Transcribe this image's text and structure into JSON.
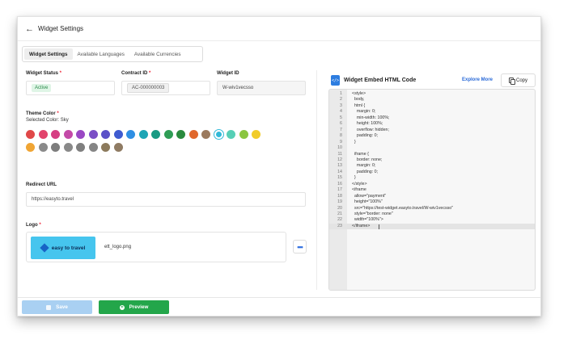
{
  "header": {
    "title": "Widget Settings"
  },
  "tabs": [
    {
      "label": "Widget Settings",
      "active": true
    },
    {
      "label": "Available Languages",
      "active": false
    },
    {
      "label": "Available Currencies",
      "active": false
    }
  ],
  "form": {
    "status": {
      "label": "Widget Status",
      "value": "Active"
    },
    "contract": {
      "label": "Contract ID",
      "value": "AC-000000003"
    },
    "widget_id": {
      "label": "Widget ID",
      "value": "W-wiv1vecsso"
    },
    "theme": {
      "label": "Theme Color",
      "selected_text": "Selected Color: Sky",
      "colors": [
        "#e04848",
        "#e2446c",
        "#d63f83",
        "#c44aa8",
        "#9a48c4",
        "#7b4fc6",
        "#5b52c8",
        "#3f5bd0",
        "#2f8fe3",
        "#1da5b5",
        "#199a83",
        "#2f9d55",
        "#2a8a3e",
        "#e0672c",
        "#9b7a5e",
        "#31b9d8",
        "#56cfb6",
        "#8ac540",
        "#f1cc2a",
        "#f0a534",
        "#8a8a8a",
        "#7d7d7d",
        "#898989",
        "#7f7f7f",
        "#858585",
        "#8c7a5c",
        "#8f7b63"
      ],
      "selected_index": 15
    },
    "redirect": {
      "label": "Redirect URL",
      "value": "https://easyto.travel"
    },
    "logo": {
      "label": "Logo",
      "brand_text": "easy to travel",
      "filename": "ett_logo.png",
      "more": "•••"
    }
  },
  "embed": {
    "icon_text": "</>",
    "title": "Widget Embed HTML Code",
    "explore": "Explore More",
    "copy": "Copy",
    "lines": [
      "<style>",
      "  body,",
      "  html {",
      "    margin: 0;",
      "    min-width: 100%;",
      "    height: 100%;",
      "    overflow: hidden;",
      "    padding: 0;",
      "  }",
      "",
      "  iframe {",
      "    border: none;",
      "    margin: 0;",
      "    padding: 0;",
      "  }",
      "</style>",
      "<iframe",
      "  allow=\"payment\"",
      "  height=\"100%\"",
      "  src=\"https://test-widget.easyto.travel/W-wiv1vecsso\"",
      "  style=\"border: none\"",
      "  width=\"100%\">",
      "</iframe>"
    ],
    "current_line": 23
  },
  "footer": {
    "save": "Save",
    "preview": "Preview"
  }
}
